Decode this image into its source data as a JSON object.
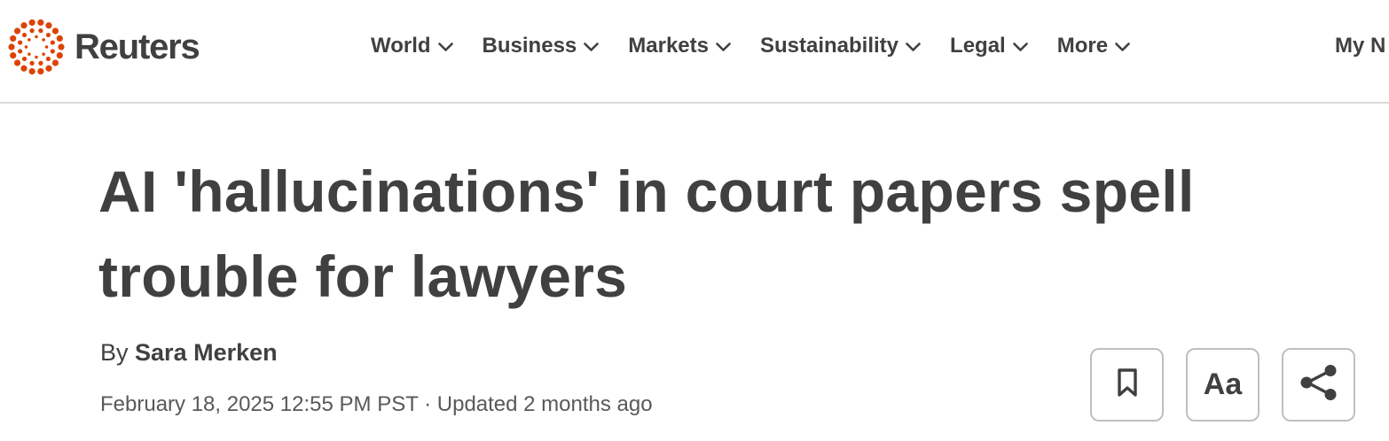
{
  "brand": {
    "name": "Reuters",
    "accent": "#dc4300"
  },
  "nav": {
    "items": [
      {
        "label": "World"
      },
      {
        "label": "Business"
      },
      {
        "label": "Markets"
      },
      {
        "label": "Sustainability"
      },
      {
        "label": "Legal"
      },
      {
        "label": "More"
      }
    ],
    "chevron_icon": "chevron-down-icon",
    "my_news": "My N"
  },
  "article": {
    "headline": "AI 'hallucinations' in court papers spell trouble for lawyers",
    "byline_prefix": "By",
    "author": "Sara Merken",
    "dateline": "February 18, 2025 12:55 PM PST · Updated 2 months ago"
  },
  "actions": {
    "bookmark_icon": "bookmark-icon",
    "text_size_label": "Aa",
    "share_icon": "share-icon"
  }
}
